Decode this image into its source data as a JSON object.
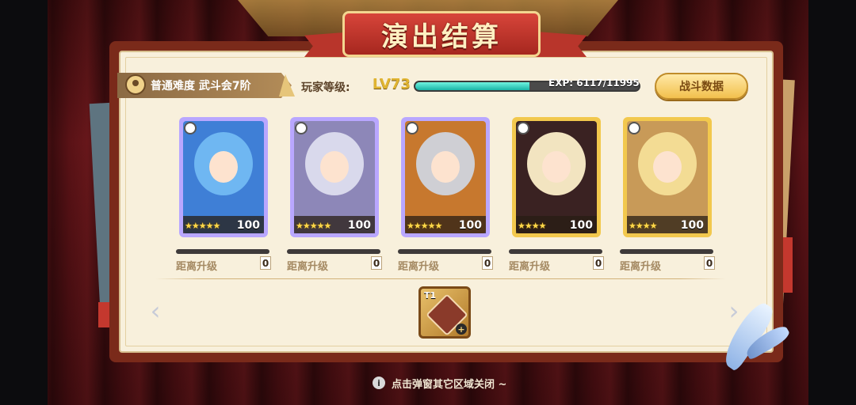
{
  "title": "演出结算",
  "difficulty": "普通难度 武斗会7阶",
  "player": {
    "level_label": "玩家等级:",
    "level": "LV73",
    "exp_text": "EXP: 6117/11995",
    "exp_progress": 0.51
  },
  "battle_data_button": "战斗数据",
  "upgrade_label": "距离升级",
  "cards": [
    {
      "level": "100",
      "stars": "★★★★★",
      "rarity": "blue",
      "hair": "#6fb7f2",
      "bg": "#3f7fd6",
      "frame": "#b9a7ff"
    },
    {
      "level": "100",
      "stars": "★★★★★",
      "rarity": "yellow",
      "hair": "#d9d9ec",
      "bg": "#8d87b8",
      "frame": "#b9a7ff"
    },
    {
      "level": "100",
      "stars": "★★★★★",
      "rarity": "orange",
      "hair": "#cfcfd4",
      "bg": "#c7782e",
      "frame": "#b9a7ff"
    },
    {
      "level": "100",
      "stars": "★★★★",
      "rarity": "purple",
      "hair": "#f2e4c0",
      "bg": "#3a2222",
      "frame": "#f2c84d"
    },
    {
      "level": "100",
      "stars": "★★★★",
      "rarity": "grey",
      "hair": "#f3dc94",
      "bg": "#c89a58",
      "frame": "#f2c84d"
    }
  ],
  "upgrade_values": [
    "0",
    "0",
    "0",
    "0",
    "0"
  ],
  "reward_item": {
    "label": "T1"
  },
  "nav": {
    "prev": "‹",
    "next": "›"
  },
  "hint": "点击弹窗其它区域关闭 ~",
  "colors": {
    "accent": "#f2c04d",
    "exp_fill": "#19b3a6"
  }
}
